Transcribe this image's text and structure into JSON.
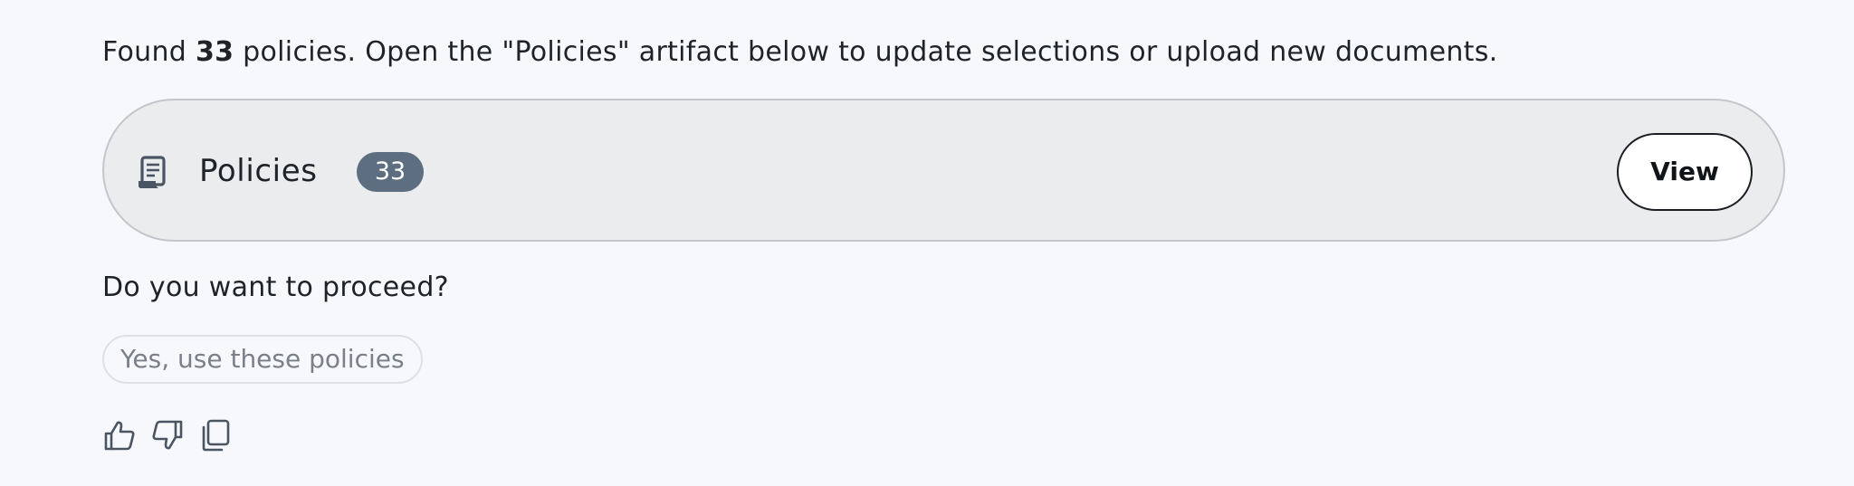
{
  "message": {
    "intro_prefix": "Found",
    "intro_count": "33",
    "intro_suffix": "policies. Open the \"Policies\" artifact below to update selections or upload new documents.",
    "question": "Do you want to proceed?"
  },
  "artifact": {
    "icon": "scroll-document-icon",
    "title": "Policies",
    "count": "33",
    "view_label": "View"
  },
  "suggestions": [
    {
      "label": "Yes, use these policies"
    }
  ],
  "actions": {
    "icons": [
      "thumbs-up-icon",
      "thumbs-down-icon",
      "copy-icon"
    ]
  },
  "colors": {
    "background": "#f7f8fb",
    "card_background": "#ebecee",
    "card_border": "#c2c6cc",
    "badge": "#5c6e80",
    "text": "#1f2328",
    "muted_text": "#7a8089"
  }
}
